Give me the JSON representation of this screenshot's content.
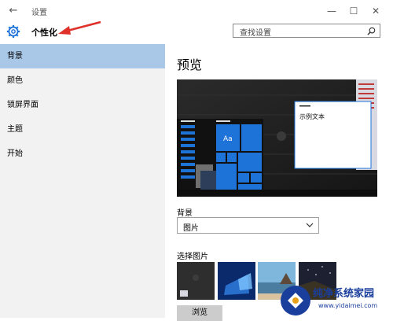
{
  "window": {
    "back_glyph": "←",
    "title": "设置",
    "minimize_glyph": "—",
    "maximize_glyph": "☐",
    "close_glyph": "✕"
  },
  "header": {
    "title": "个性化",
    "search_placeholder": "查找设置"
  },
  "sidebar": {
    "items": [
      {
        "label": "背景",
        "active": true
      },
      {
        "label": "颜色",
        "active": false
      },
      {
        "label": "锁屏界面",
        "active": false
      },
      {
        "label": "主题",
        "active": false
      },
      {
        "label": "开始",
        "active": false
      }
    ]
  },
  "main": {
    "title": "预览",
    "preview_tile_text": "Aa",
    "preview_sample_text": "示例文本",
    "background_label": "背景",
    "background_value": "图片",
    "choose_picture_label": "选择图片",
    "browse_label": "浏览"
  },
  "watermark": {
    "text": "纯净系统家园",
    "url": "www.yidaimei.com"
  },
  "colors": {
    "accent": "#1e73d8",
    "selected_nav": "#a9c8e8",
    "sidebar_bg": "#f2f2f2",
    "arrow": "#e0302a"
  }
}
